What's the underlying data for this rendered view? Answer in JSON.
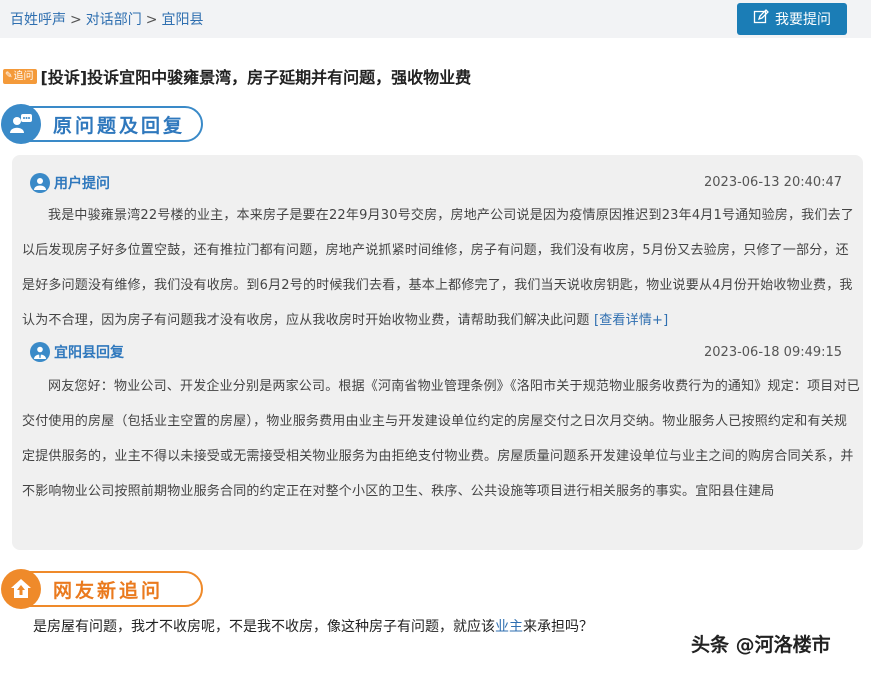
{
  "breadcrumb": {
    "items": [
      "百姓呼声",
      "对话部门",
      "宜阳县"
    ],
    "separator": ">"
  },
  "ask_button": {
    "label": "我要提问",
    "icon": "edit-icon"
  },
  "question": {
    "tag": "追问",
    "title": "[投诉]投诉宜阳中骏雍景湾，房子延期并有问题，强收物业费"
  },
  "section_original": {
    "label": "原问题及回复",
    "icon": "chat-person-icon"
  },
  "user_question": {
    "who": "用户提问",
    "time": "2023-06-13 20:40:47",
    "text": "我是中骏雍景湾22号楼的业主，本来房子是要在22年9月30号交房，房地产公司说是因为疫情原因推迟到23年4月1号通知验房，我们去了以后发现房子好多位置空鼓，还有推拉门都有问题，房地产说抓紧时间维修，房子有问题，我们没有收房，5月份又去验房，只修了一部分，还是好多问题没有维修，我们没有收房。到6月2号的时候我们去看，基本上都修完了，我们当天说收房钥匙，物业说要从4月份开始收物业费，我认为不合理，因为房子有问题我才没有收房，应从我收房时开始收物业费，请帮助我们解决此问题",
    "detail_link": "[查看详情+]"
  },
  "reply": {
    "who": "宜阳县回复",
    "time": "2023-06-18 09:49:15",
    "text": "网友您好：物业公司、开发企业分别是两家公司。根据《河南省物业管理条例》《洛阳市关于规范物业服务收费行为的通知》规定：项目对已交付使用的房屋（包括业主空置的房屋），物业服务费用由业主与开发建设单位约定的房屋交付之日次月交纳。物业服务人已按照约定和有关规定提供服务的，业主不得以未接受或无需接受相关物业服务为由拒绝支付物业费。房屋质量问题系开发建设单位与业主之间的购房合同关系，并不影响物业公司按照前期物业服务合同的约定正在对整个小区的卫生、秩序、公共设施等项目进行相关服务的事实。宜阳县住建局"
  },
  "section_followup": {
    "label": "网友新追问",
    "icon": "house-up-icon"
  },
  "followup": {
    "before": "是房屋有问题，我才不收房呢，不是我不收房，像这种房子有问题，就应该",
    "highlight": "业主",
    "after": "来承担吗？"
  },
  "watermark": "头条 @河洛楼市",
  "colors": {
    "accent": "#1b7db6",
    "section_blue": "#3a8ac8",
    "section_orange": "#ef8a2a",
    "tag": "#f49a3a"
  }
}
